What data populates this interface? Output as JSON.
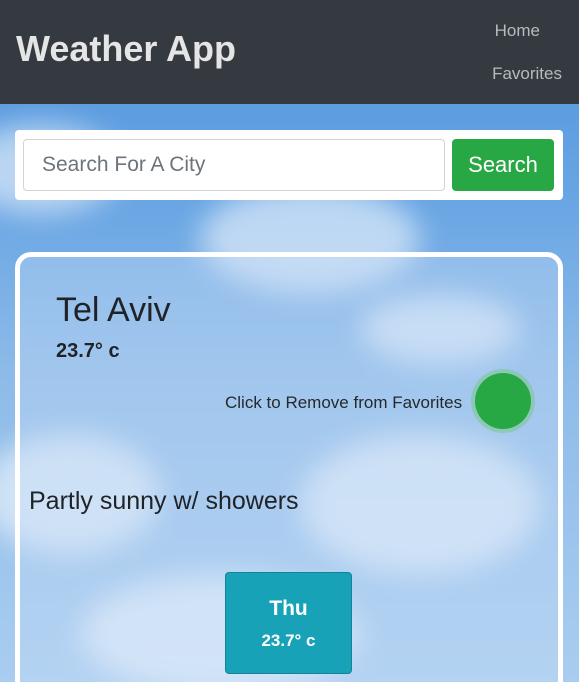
{
  "app": {
    "title": "Weather App"
  },
  "nav": {
    "home": "Home",
    "favorites": "Favorites"
  },
  "search": {
    "placeholder": "Search For A City",
    "value": "",
    "button_label": "Search"
  },
  "current": {
    "city": "Tel Aviv",
    "temperature": "23.7° c",
    "favorite_action": "Click to Remove from Favorites",
    "condition": "Partly sunny w/ showers"
  },
  "forecast": [
    {
      "day": "Thu",
      "temperature": "23.7° c"
    }
  ],
  "colors": {
    "navbar": "#343a40",
    "search_button": "#28a745",
    "favorite_toggle": "#28a745",
    "forecast_card": "#17a2b8"
  }
}
